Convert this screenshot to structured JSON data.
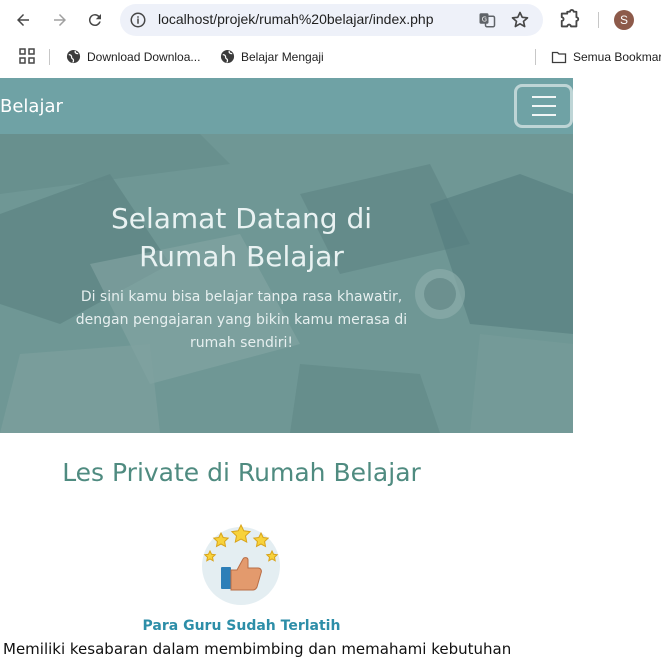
{
  "browser": {
    "url": "localhost/projek/rumah%20belajar/index.php",
    "profile_initial": "S",
    "bookmarks": [
      {
        "label": "Download Downloa..."
      },
      {
        "label": "Belajar Mengaji"
      },
      {
        "label": "Semua Bookmark"
      }
    ]
  },
  "navbar": {
    "brand": "Belajar"
  },
  "hero": {
    "title": "Selamat Datang di Rumah Belajar",
    "text": "Di sini kamu bisa belajar tanpa rasa khawatir, dengan pengajaran yang bikin kamu merasa di rumah sendiri!"
  },
  "section": {
    "title": "Les Private di Rumah Belajar",
    "feature_title": "Para Guru Sudah Terlatih",
    "feature_text": "Memiliki kesabaran dalam membimbing dan memahami kebutuhan"
  },
  "colors": {
    "navbar": "#6fa2a5",
    "section_title": "#4f8b80",
    "feature_title": "#2d8ea8"
  }
}
